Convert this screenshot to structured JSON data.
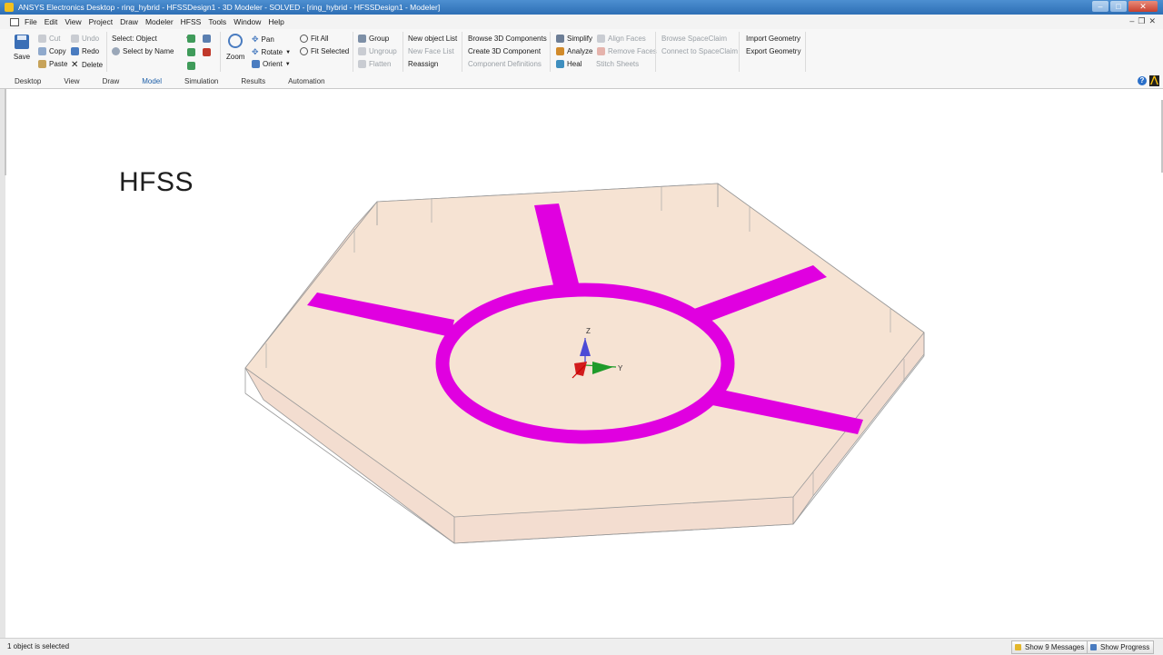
{
  "window": {
    "title": "ANSYS Electronics Desktop - ring_hybrid - HFSSDesign1 - 3D Modeler - SOLVED - [ring_hybrid - HFSSDesign1 - Modeler]"
  },
  "menu": {
    "items": [
      "File",
      "Edit",
      "View",
      "Project",
      "Draw",
      "Modeler",
      "HFSS",
      "Tools",
      "Window",
      "Help"
    ]
  },
  "ribbon": {
    "save": "Save",
    "cut": "Cut",
    "copy": "Copy",
    "paste": "Paste",
    "undo": "Undo",
    "redo": "Redo",
    "delete": "Delete",
    "select": "Select: Object",
    "select_by_name": "Select by Name",
    "zoom": "Zoom",
    "pan": "Pan",
    "rotate": "Rotate",
    "orient": "Orient",
    "fit_all": "Fit All",
    "fit_selected": "Fit Selected",
    "group": "Group",
    "ungroup": "Ungroup",
    "flatten": "Flatten",
    "new_object_list": "New object List",
    "new_face_list": "New Face List",
    "reassign": "Reassign",
    "browse_3d": "Browse 3D Components",
    "create_3d": "Create 3D Component",
    "component_defs": "Component Definitions",
    "simplify": "Simplify",
    "analyze": "Analyze",
    "heal": "Heal",
    "align_faces": "Align Faces",
    "remove_faces": "Remove Faces",
    "stitch_sheets": "Stitch Sheets",
    "browse_spaceclaim": "Browse SpaceClaim",
    "connect_spaceclaim": "Connect to SpaceClaim",
    "import_geometry": "Import Geometry",
    "export_geometry": "Export Geometry"
  },
  "tabs": [
    "Desktop",
    "View",
    "Draw",
    "Model",
    "Simulation",
    "Results",
    "Automation"
  ],
  "active_tab": "Model",
  "viewport": {
    "label": "HFSS",
    "axes": {
      "z": "Z",
      "y": "Y",
      "x": "X"
    },
    "colors": {
      "substrate": "#f6e3d3",
      "trace": "#e000e0"
    }
  },
  "status": {
    "text": "1 object is selected",
    "messages_button": "Show 9 Messages",
    "progress_button": "Show Progress"
  }
}
